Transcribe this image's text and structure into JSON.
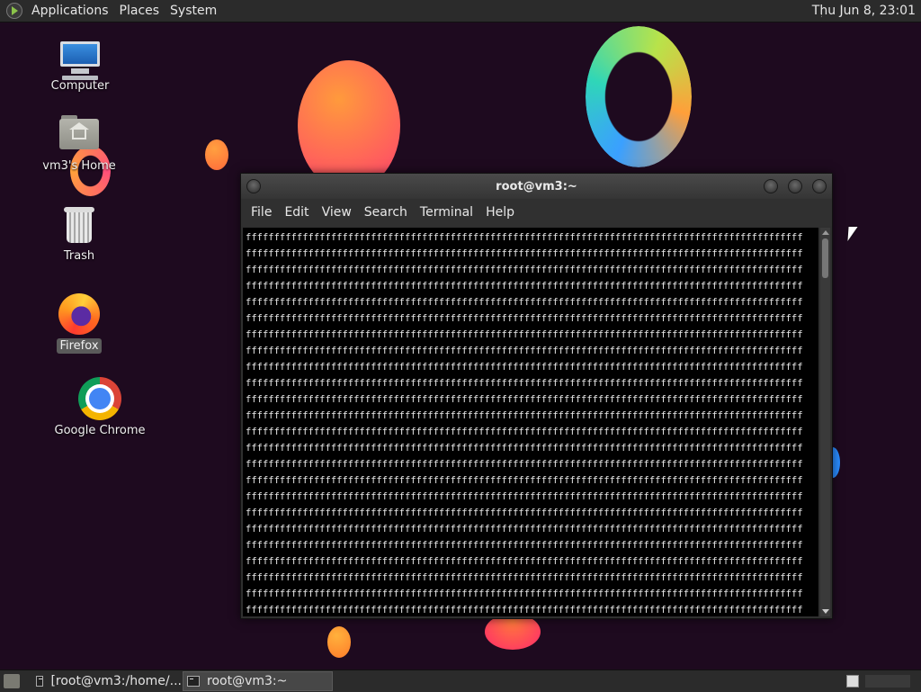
{
  "top_panel": {
    "menus": [
      "Applications",
      "Places",
      "System"
    ],
    "clock": "Thu Jun  8, 23:01"
  },
  "desktop_icons": [
    {
      "label": "Computer",
      "icon": "computer-icon"
    },
    {
      "label": "vm3's Home",
      "icon": "home-folder-icon"
    },
    {
      "label": "Trash",
      "icon": "trash-icon"
    },
    {
      "label": "Firefox",
      "icon": "firefox-icon",
      "selected": true
    },
    {
      "label": "Google Chrome",
      "icon": "chrome-icon"
    }
  ],
  "terminal": {
    "title": "root@vm3:~",
    "menu": [
      "File",
      "Edit",
      "View",
      "Search",
      "Terminal",
      "Help"
    ],
    "line_text": "ffffffffffffffffffffffffffffffffffffffffffffffffffffffffffffffffffffffffffffffffffffffffffffffffff",
    "line_count": 24
  },
  "taskbar": {
    "tasks": [
      {
        "label": "[root@vm3:/home/...",
        "active": false
      },
      {
        "label": "root@vm3:~",
        "active": true
      }
    ]
  }
}
